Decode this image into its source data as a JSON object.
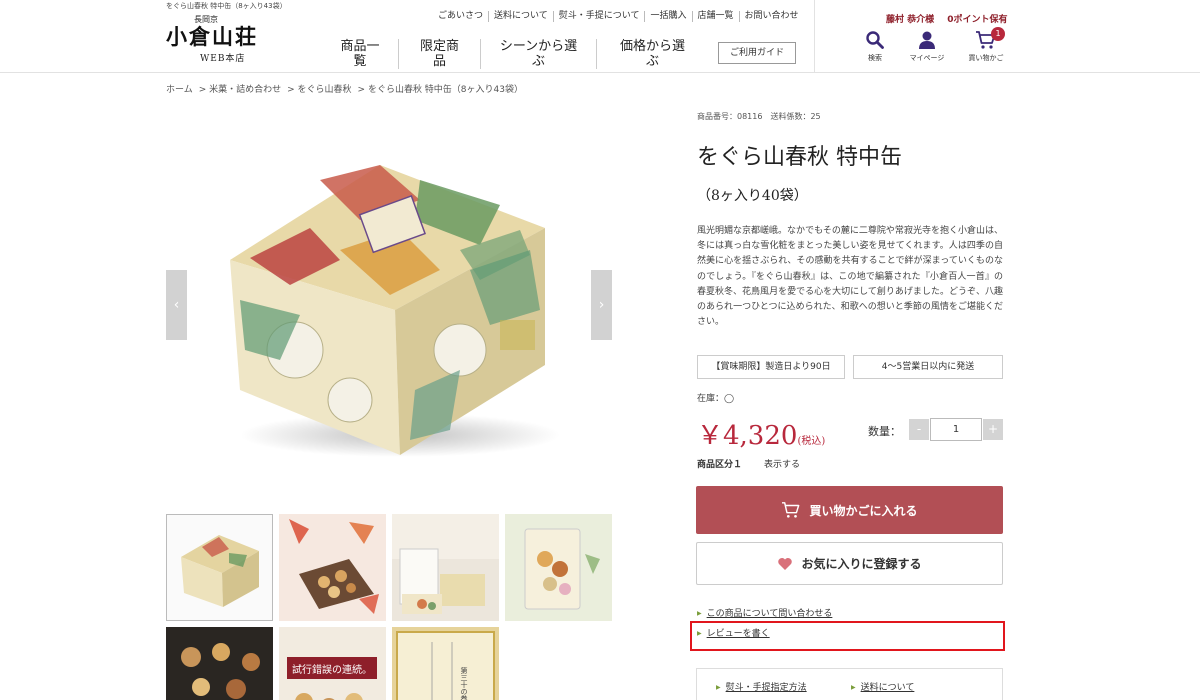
{
  "header": {
    "tagline": "をぐら山春秋 特中缶（8ヶ入り43袋）",
    "logo_small": "長岡京",
    "logo_main": "小倉山荘",
    "logo_sub": "WEB本店",
    "top_links": [
      "ごあいさつ",
      "送料について",
      "熨斗・手提について",
      "一括購入",
      "店舗一覧",
      "お問い合わせ"
    ],
    "nav": [
      {
        "line1": "商品一",
        "line2": "覧"
      },
      {
        "line1": "限定商",
        "line2": "品"
      },
      {
        "line1": "シーンから選ぶ",
        "line2": ""
      },
      {
        "line1": "価格から選",
        "line2": "ぶ"
      }
    ],
    "guide": "ご利用ガイド",
    "user_name": "藤村 恭介様",
    "points": "0ポイント保有",
    "icons": {
      "search": "検索",
      "mypage": "マイページ",
      "cart": "買い物かご"
    },
    "cart_count": "1"
  },
  "breadcrumb": [
    "ホーム",
    "> 米菓・詰め合わせ",
    "> をぐら山春秋",
    "> をぐら山春秋 特中缶（8ヶ入り43袋）"
  ],
  "product": {
    "code": "商品番号：08116　送料係数：25",
    "title_main": "をぐら山春秋 特中缶",
    "title_sub": "（8ヶ入り40袋）",
    "description": "風光明媚な京都嵯峨。なかでもその麓に二尊院や常寂光寺を抱く小倉山は、冬には真っ白な雪化粧をまとった美しい姿を見せてくれます。人は四季の自然美に心を揺さぶられ、その感動を共有することで絆が深まっていくものなのでしょう。『をぐら山春秋』は、この地で編纂された『小倉百人一首』の春夏秋冬、花鳥風月を愛でる心を大切にして創りあげました。どうぞ、八趣のあられ一つひとつに込められた、和歌への想いと季節の風情をご堪能ください。",
    "shelf_life": "【賞味期限】製造日より90日",
    "shipping": "4〜5営業日以内に発送",
    "stock": "在庫：◯",
    "price": "￥4,320",
    "tax": "(税込)",
    "qty_label": "数量：",
    "qty_minus": "-",
    "qty_value": "1",
    "qty_plus": "+",
    "kubun_label": "商品区分１",
    "kubun_value": "表示する",
    "cart_button": "買い物かごに入れる",
    "fav_button": "お気に入りに登録する",
    "inquiry_link": "この商品について問い合わせる",
    "review_link": "レビューを書く",
    "noshi_link": "熨斗・手提指定方法",
    "shipping_link": "送料について"
  },
  "thumbnails": {
    "t5_text": "試行錯誤の連続。",
    "t6_text": "第三十の巻"
  },
  "colors": {
    "accent": "#b24f55",
    "price": "#b8283c",
    "highlight": "#e1161d",
    "link_marker": "#7a9d3a"
  }
}
